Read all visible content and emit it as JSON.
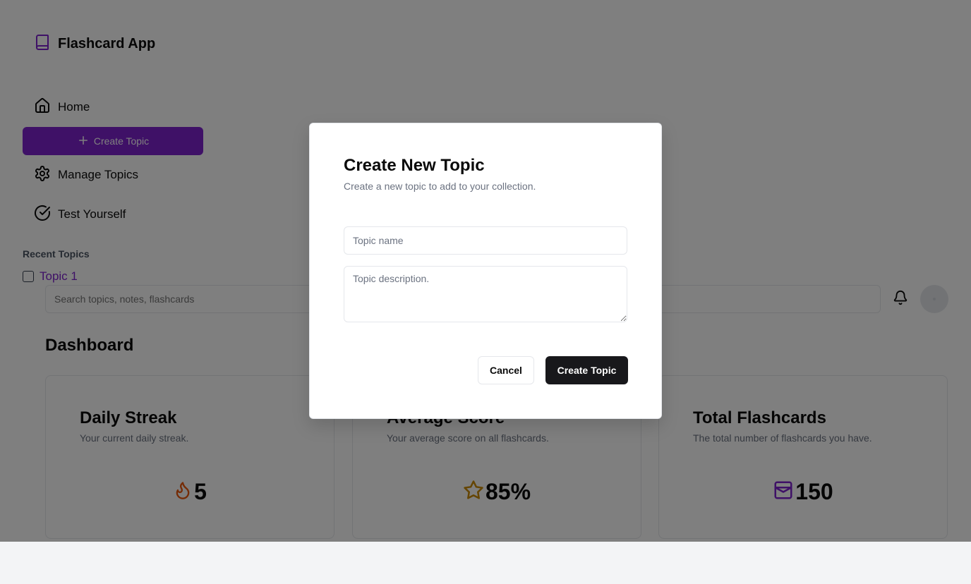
{
  "brand": {
    "title": "Flashcard App",
    "icon": "book-icon"
  },
  "sidebar": {
    "items": [
      {
        "label": "Home",
        "icon": "home-icon"
      },
      {
        "label": "Create Topic",
        "icon": "plus-icon"
      },
      {
        "label": "Manage Topics",
        "icon": "gear-icon"
      },
      {
        "label": "Test Yourself",
        "icon": "check-circle-icon"
      }
    ],
    "recent_heading": "Recent Topics",
    "recent_topics": [
      {
        "label": "Topic 1"
      }
    ]
  },
  "header": {
    "search_placeholder": "Search topics, notes, flashcards",
    "bell_icon": "bell-icon"
  },
  "dashboard": {
    "title": "Dashboard",
    "cards": [
      {
        "title": "Daily Streak",
        "description": "Your current daily streak.",
        "value": "5",
        "icon": "flame-icon"
      },
      {
        "title": "Average Score",
        "description": "Your average score on all flashcards.",
        "value": "85%",
        "icon": "star-icon"
      },
      {
        "title": "Total Flashcards",
        "description": "The total number of flashcards you have.",
        "value": "150",
        "icon": "inbox-icon"
      }
    ]
  },
  "modal": {
    "title": "Create New Topic",
    "description": "Create a new topic to add to your collection.",
    "name_placeholder": "Topic name",
    "description_placeholder": "Topic description.",
    "cancel_label": "Cancel",
    "submit_label": "Create Topic"
  },
  "colors": {
    "accent": "#7e22ce",
    "overlay": "rgba(0,0,0,0.5)",
    "primary_button": "#18181b",
    "flame": "#ea580c",
    "star": "#ca8a04"
  }
}
